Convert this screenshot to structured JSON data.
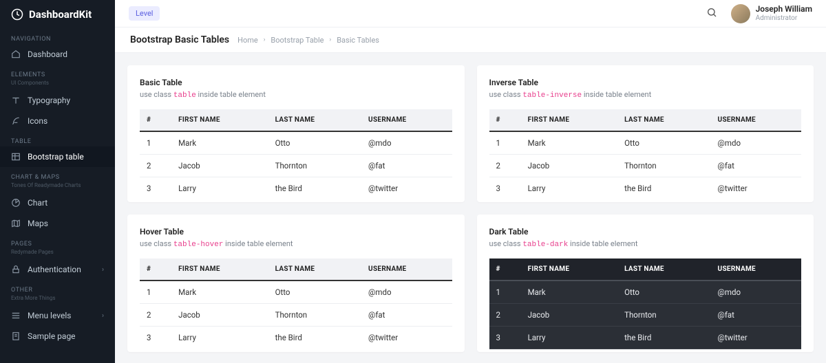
{
  "brand": "DashboardKit",
  "topbar": {
    "level_label": "Level",
    "user_name": "Joseph William",
    "user_role": "Administrator"
  },
  "breadcrumb": {
    "page_title": "Bootstrap Basic Tables",
    "items": [
      "Home",
      "Bootstrap Table",
      "Basic Tables"
    ]
  },
  "sidebar": {
    "sections": [
      {
        "label": "NAVIGATION",
        "sublabel": "",
        "items": [
          {
            "icon": "home",
            "text": "Dashboard"
          }
        ]
      },
      {
        "label": "ELEMENTS",
        "sublabel": "UI Components",
        "items": [
          {
            "icon": "type",
            "text": "Typography"
          },
          {
            "icon": "feather",
            "text": "Icons"
          }
        ]
      },
      {
        "label": "TABLE",
        "sublabel": "",
        "items": [
          {
            "icon": "table",
            "text": "Bootstrap table",
            "active": true
          }
        ]
      },
      {
        "label": "CHART & MAPS",
        "sublabel": "Tones Of Readymade Charts",
        "items": [
          {
            "icon": "pie",
            "text": "Chart"
          },
          {
            "icon": "map",
            "text": "Maps"
          }
        ]
      },
      {
        "label": "PAGES",
        "sublabel": "Redymade Pages",
        "items": [
          {
            "icon": "lock",
            "text": "Authentication",
            "chevron": true
          }
        ]
      },
      {
        "label": "OTHER",
        "sublabel": "Extra More Things",
        "items": [
          {
            "icon": "menu",
            "text": "Menu levels",
            "chevron": true
          },
          {
            "icon": "page",
            "text": "Sample page"
          }
        ]
      }
    ]
  },
  "columns": [
    "#",
    "FIRST NAME",
    "LAST NAME",
    "USERNAME"
  ],
  "rows": [
    [
      "1",
      "Mark",
      "Otto",
      "@mdo"
    ],
    [
      "2",
      "Jacob",
      "Thornton",
      "@fat"
    ],
    [
      "3",
      "Larry",
      "the Bird",
      "@twitter"
    ]
  ],
  "cards": {
    "basic": {
      "title": "Basic Table",
      "sub_pre": "use class ",
      "code": "table",
      "sub_post": " inside table element"
    },
    "inverse": {
      "title": "Inverse Table",
      "sub_pre": "use class ",
      "code": "table-inverse",
      "sub_post": " inside table element"
    },
    "hover": {
      "title": "Hover Table",
      "sub_pre": "use class ",
      "code": "table-hover",
      "sub_post": " inside table element"
    },
    "dark": {
      "title": "Dark Table",
      "sub_pre": "use class ",
      "code": "table-dark",
      "sub_post": " inside table element"
    }
  }
}
